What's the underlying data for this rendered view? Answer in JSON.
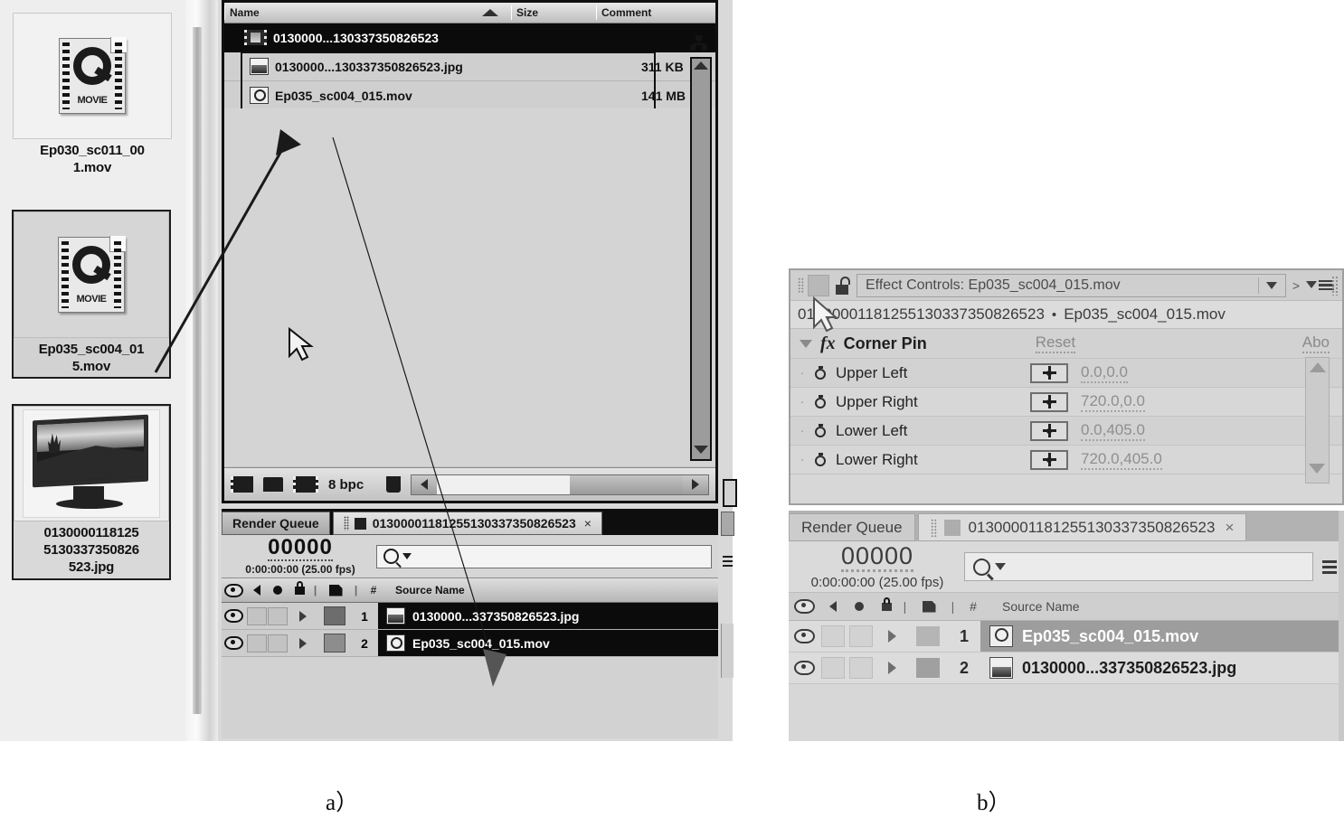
{
  "panel_a": {
    "browser": {
      "files": [
        {
          "name": "Ep030_sc011_001.mov",
          "icon": "quicktime-movie-icon",
          "selected": false
        },
        {
          "name": "Ep035_sc004_015.mov",
          "icon": "quicktime-movie-icon",
          "selected": true
        },
        {
          "name": "0130000118125513033735082  6523.jpg",
          "icon": "monitor-photo-thumbnail",
          "selected": true
        }
      ],
      "file_labels": [
        "Ep030_sc011_001.mov",
        "Ep035_sc004_015.mov",
        "0130000118125513033735082 6523.jpg"
      ],
      "label_lines": [
        [
          "Ep030_sc011_00",
          "1.mov"
        ],
        [
          "Ep035_sc004_01",
          "5.mov"
        ],
        [
          "0130000118125",
          "5130337350826",
          "523.jpg"
        ]
      ]
    },
    "project_panel": {
      "columns": [
        "Name",
        "Size",
        "Comment"
      ],
      "sort_indicator": "ascending-triangle",
      "rows": [
        {
          "name": "0130000...130337350826523",
          "size": "",
          "comment": "",
          "icon": "footage-film-icon",
          "selected": true
        },
        {
          "name": "0130000...130337350826523.jpg",
          "size": "311 KB",
          "comment": "",
          "icon": "still-image-icon",
          "selected": false
        },
        {
          "name": "Ep035_sc004_015.mov",
          "size": "141 MB",
          "comment": "",
          "icon": "movie-file-icon",
          "selected": false
        }
      ],
      "toolbar": {
        "bit_depth": "8 bpc",
        "icons": [
          "new-composition-icon",
          "new-folder-icon",
          "interpret-footage-icon",
          "delete-trash-icon"
        ]
      }
    },
    "timeline": {
      "tabs": [
        {
          "label": "Render Queue",
          "active": false,
          "closeable": false
        },
        {
          "label": "0130000118125513033735082 6523",
          "active": true,
          "closeable": true
        }
      ],
      "tab_labels": [
        "Render Queue",
        "01300001181255130337350826523"
      ],
      "timecode_big": "00000",
      "timecode_sub": "0:00:00:00 (25.00 fps)",
      "search_placeholder": "",
      "layer_columns": [
        "#",
        "Source Name"
      ],
      "layers": [
        {
          "number": "1",
          "source_name": "0130000...337350826523.jpg",
          "icon": "still-image-icon",
          "selected": true
        },
        {
          "number": "2",
          "source_name": "Ep035_sc004_015.mov",
          "icon": "movie-file-icon",
          "selected": true
        }
      ]
    }
  },
  "panel_b": {
    "effect_controls": {
      "title": "Effect Controls: Ep035_sc004_015.mov",
      "subtitle_comp": "01300001181255130337350826523",
      "subtitle_sep": "•",
      "subtitle_layer": "Ep035_sc004_015.mov",
      "effect_name": "Corner Pin",
      "reset_label": "Reset",
      "about_label": "Abo",
      "properties": [
        {
          "name": "Upper Left",
          "value": "0.0,0.0"
        },
        {
          "name": "Upper Right",
          "value": "720.0,0.0"
        },
        {
          "name": "Lower Left",
          "value": "0.0,405.0"
        },
        {
          "name": "Lower Right",
          "value": "720.0,405.0"
        }
      ]
    },
    "timeline": {
      "tabs": [
        {
          "label": "Render Queue",
          "active": false,
          "closeable": false
        },
        {
          "label": "01300001181255130337350826523",
          "active": true,
          "closeable": true
        }
      ],
      "tab_labels": [
        "Render Queue",
        "01300001181255130337350826523"
      ],
      "timecode_big": "00000",
      "timecode_sub": "0:00:00:00 (25.00 fps)",
      "search_placeholder": "",
      "layer_columns": [
        "#",
        "Source Name"
      ],
      "layers": [
        {
          "number": "1",
          "source_name": "Ep035_sc004_015.mov",
          "icon": "movie-file-icon",
          "selected": true
        },
        {
          "number": "2",
          "source_name": "0130000...337350826523.jpg",
          "icon": "still-image-icon",
          "selected": false
        }
      ]
    }
  },
  "captions": {
    "a": "a）",
    "b": "b）"
  },
  "colors": {
    "background": "#ffffff",
    "panel_a_chrome": "#d9d9d9",
    "panel_b_chrome": "#d7d7d7",
    "selection_dark": "#0b0b0b",
    "selection_gray": "#9d9d9d"
  }
}
